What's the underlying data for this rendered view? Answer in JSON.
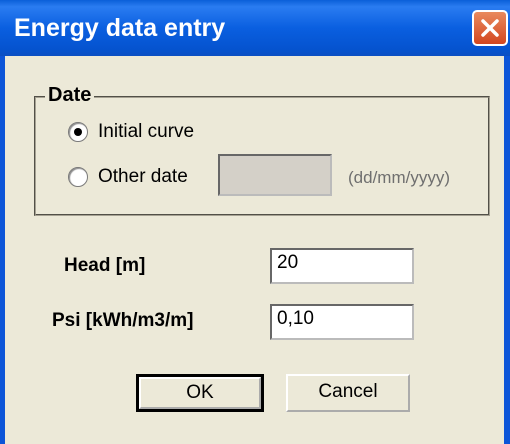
{
  "window": {
    "title": "Energy data entry"
  },
  "date_group": {
    "label": "Date",
    "initial_curve": {
      "label": "Initial curve",
      "selected": true
    },
    "other_date": {
      "label": "Other date",
      "selected": false,
      "value": "",
      "hint": "(dd/mm/yyyy)"
    }
  },
  "fields": {
    "head": {
      "label": "Head [m]",
      "value": "20"
    },
    "psi": {
      "label": "Psi [kWh/m3/m]",
      "value": "0,10"
    }
  },
  "buttons": {
    "ok": "OK",
    "cancel": "Cancel"
  }
}
